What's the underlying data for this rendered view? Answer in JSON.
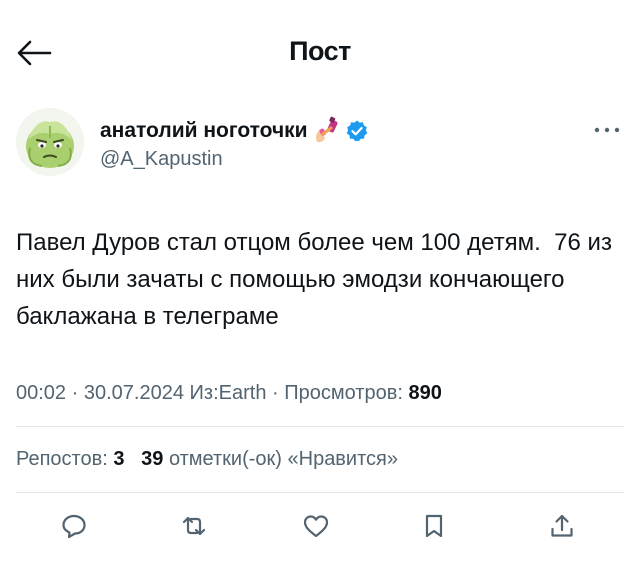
{
  "header": {
    "title": "Пост",
    "back_icon": "arrow-left-icon"
  },
  "author": {
    "name": "анатолий ноготочки",
    "handle": "@A_Kapustin",
    "emoji": "nail-polish-emoji",
    "verified_color": "#1d9bf0",
    "avatar": "cabbage-avatar"
  },
  "post": {
    "text": "Павел Дуров стал отцом более чем 100 детям.  76 из них были зачаты с помощью эмодзи кончающего баклажана в телеграме",
    "time": "00:02",
    "date": "30.07.2024",
    "source": "Из:Earth",
    "views_label": "Просмотров:",
    "views_count": "890",
    "separator": "·"
  },
  "stats": {
    "reposts_label": "Репостов:",
    "reposts_count": "3",
    "likes_count": "39",
    "likes_label": "отметки(-ок) «Нравится»"
  },
  "actions": [
    "reply-icon",
    "repost-icon",
    "like-icon",
    "bookmark-icon",
    "share-icon"
  ],
  "colors": {
    "text": "#0f1419",
    "secondary": "#536471",
    "divider": "#e3e7ea",
    "accent": "#1d9bf0"
  }
}
